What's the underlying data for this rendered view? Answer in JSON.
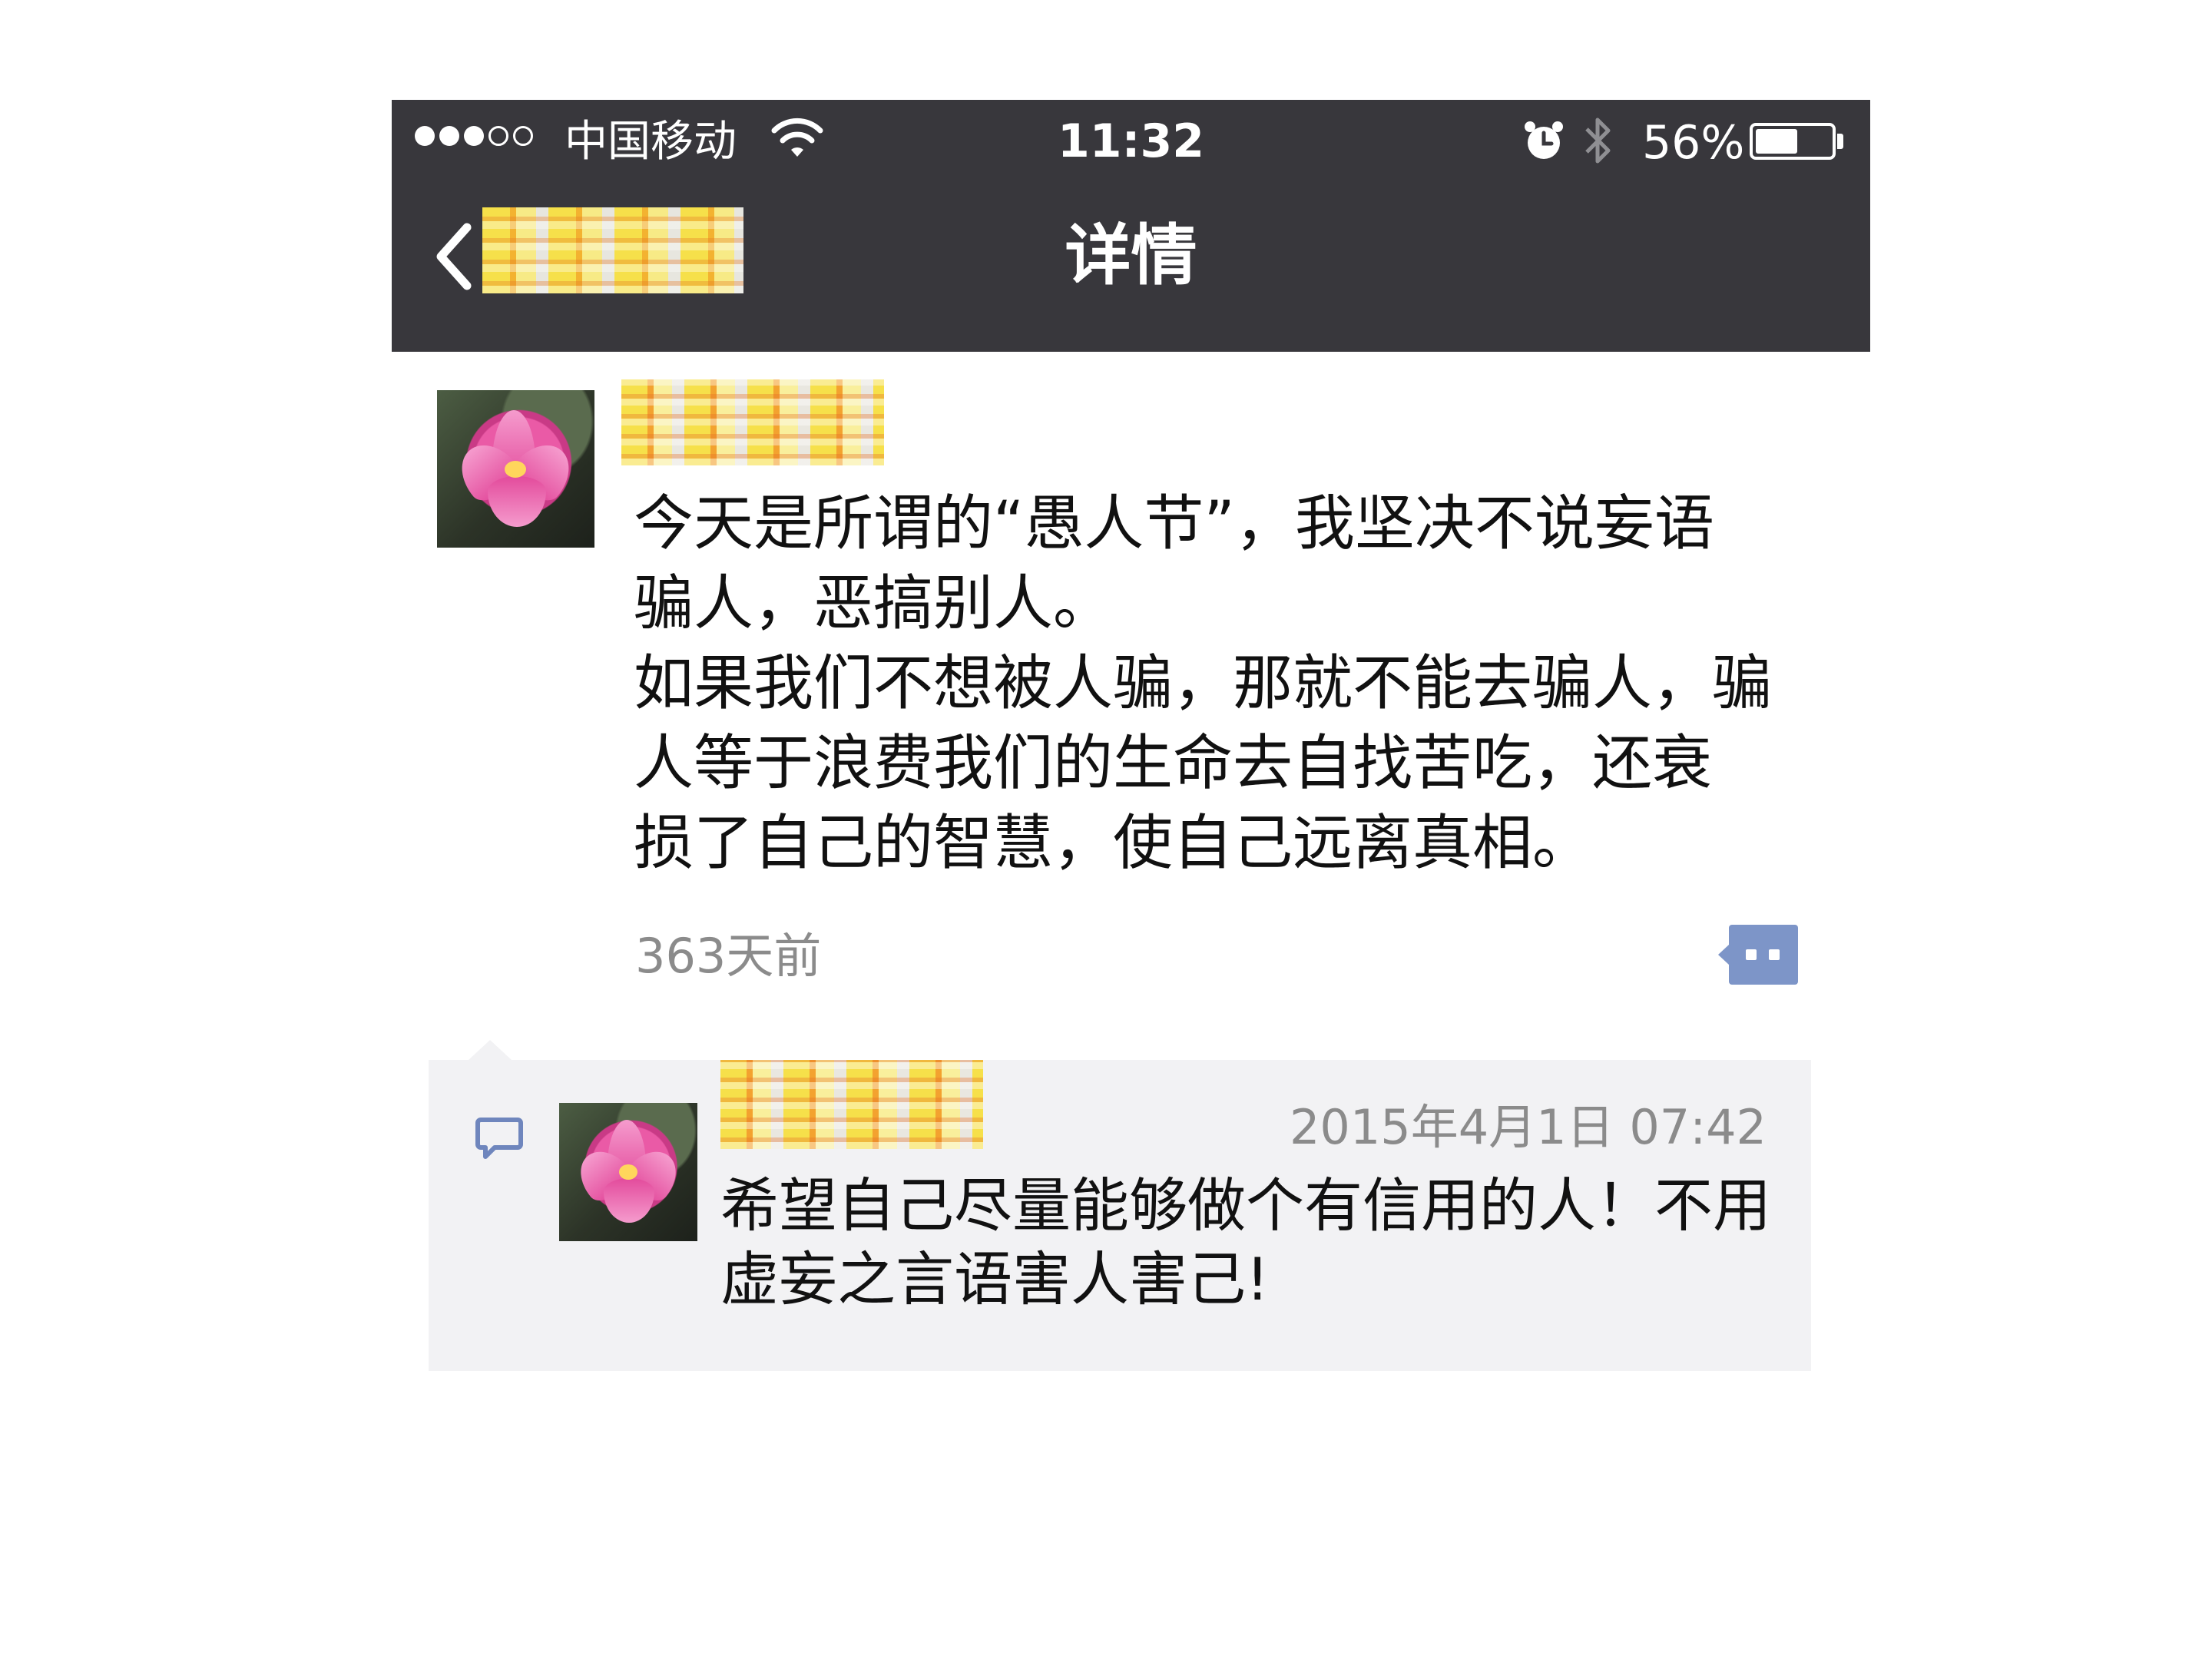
{
  "status_bar": {
    "signal_dots_filled": 3,
    "signal_dots_total": 5,
    "carrier": "中国移动",
    "time": "11:32",
    "battery_percent_text": "56%",
    "battery_level": 0.56,
    "icons": [
      "wifi-icon",
      "alarm-icon",
      "bluetooth-icon",
      "battery-icon"
    ]
  },
  "nav": {
    "title": "详情",
    "back_icon": "chevron-left-icon"
  },
  "post": {
    "text": "今天是所谓的“愚人节”，我坚决不说妄语\n骗人，恶搞别人。\n如果我们不想被人骗，那就不能去骗人，骗\n人等于浪费我们的生命去自找苦吃，还衰\n损了自己的智慧，使自己远离真相。",
    "time": "363天前"
  },
  "comment": {
    "time": "2015年4月1日 07:42",
    "text": "希望自己尽量能够做个有信用的人！不用\n虚妄之言语害人害己!"
  },
  "colors": {
    "topbar": "#38373c",
    "comment_bg": "#f2f2f4",
    "accent_blue": "#7d95c8",
    "muted_text": "#8b8b8b"
  }
}
